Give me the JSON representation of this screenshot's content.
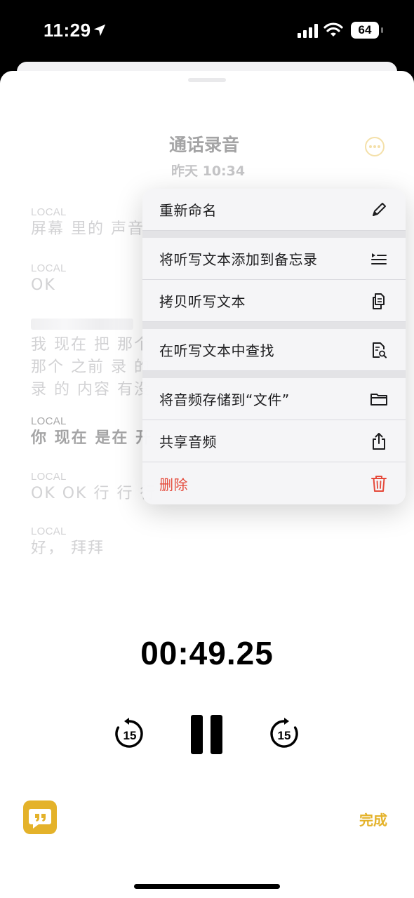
{
  "status_bar": {
    "time": "11:29",
    "battery": "64"
  },
  "sheet": {
    "title": "通话录音",
    "subtitle": "昨天 10:34"
  },
  "transcript": [
    {
      "label": "LOCAL",
      "text": "屏幕 里的 声音"
    },
    {
      "label": "LOCAL",
      "text": "OK"
    },
    {
      "label": "",
      "lines": [
        "我 现在 把 那个",
        "那个 之前 录 的",
        "录 的 内容 有没"
      ]
    },
    {
      "label": "LOCAL",
      "text": "你 现在 是在 开"
    },
    {
      "label": "LOCAL",
      "text": "OK OK 行 行 行"
    },
    {
      "label": "LOCAL",
      "text": "好， 拜拜"
    }
  ],
  "menu": {
    "rename": "重新命名",
    "add_to_notes": "将听写文本添加到备忘录",
    "copy_text": "拷贝听写文本",
    "find_in_text": "在听写文本中查找",
    "save_to_files": "将音频存储到“文件”",
    "share_audio": "共享音频",
    "delete": "删除"
  },
  "player": {
    "timer": "00:49.25",
    "skip_back": "15",
    "skip_forward": "15"
  },
  "bottom": {
    "done": "完成"
  },
  "colors": {
    "accent": "#e4b22a",
    "danger": "#e5493a"
  }
}
